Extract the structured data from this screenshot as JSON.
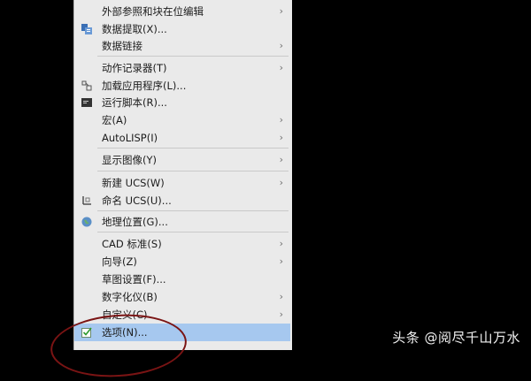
{
  "menu": {
    "items": [
      {
        "label": "外部参照和块在位编辑",
        "submenu": true
      },
      {
        "label": "数据提取(X)...",
        "icon": "data-extract-icon"
      },
      {
        "label": "数据链接",
        "submenu": true
      },
      {
        "label": "动作记录器(T)",
        "submenu": true
      },
      {
        "label": "加载应用程序(L)...",
        "icon": "load-app-icon"
      },
      {
        "label": "运行脚本(R)...",
        "icon": "script-icon"
      },
      {
        "label": "宏(A)",
        "submenu": true
      },
      {
        "label": "AutoLISP(I)",
        "submenu": true
      },
      {
        "label": "显示图像(Y)",
        "submenu": true
      },
      {
        "label": "新建 UCS(W)",
        "submenu": true
      },
      {
        "label": "命名 UCS(U)...",
        "icon": "ucs-icon"
      },
      {
        "label": "地理位置(G)...",
        "icon": "globe-icon"
      },
      {
        "label": "CAD 标准(S)",
        "submenu": true
      },
      {
        "label": "向导(Z)",
        "submenu": true
      },
      {
        "label": "草图设置(F)..."
      },
      {
        "label": "数字化仪(B)",
        "submenu": true
      },
      {
        "label": "自定义(C)",
        "submenu": true
      },
      {
        "label": "选项(N)...",
        "icon": "options-check-icon",
        "active": true
      }
    ]
  },
  "watermark": "头条 @阅尽千山万水",
  "colors": {
    "highlight": "#a6c8ef",
    "annotation_circle": "#7a1414"
  }
}
